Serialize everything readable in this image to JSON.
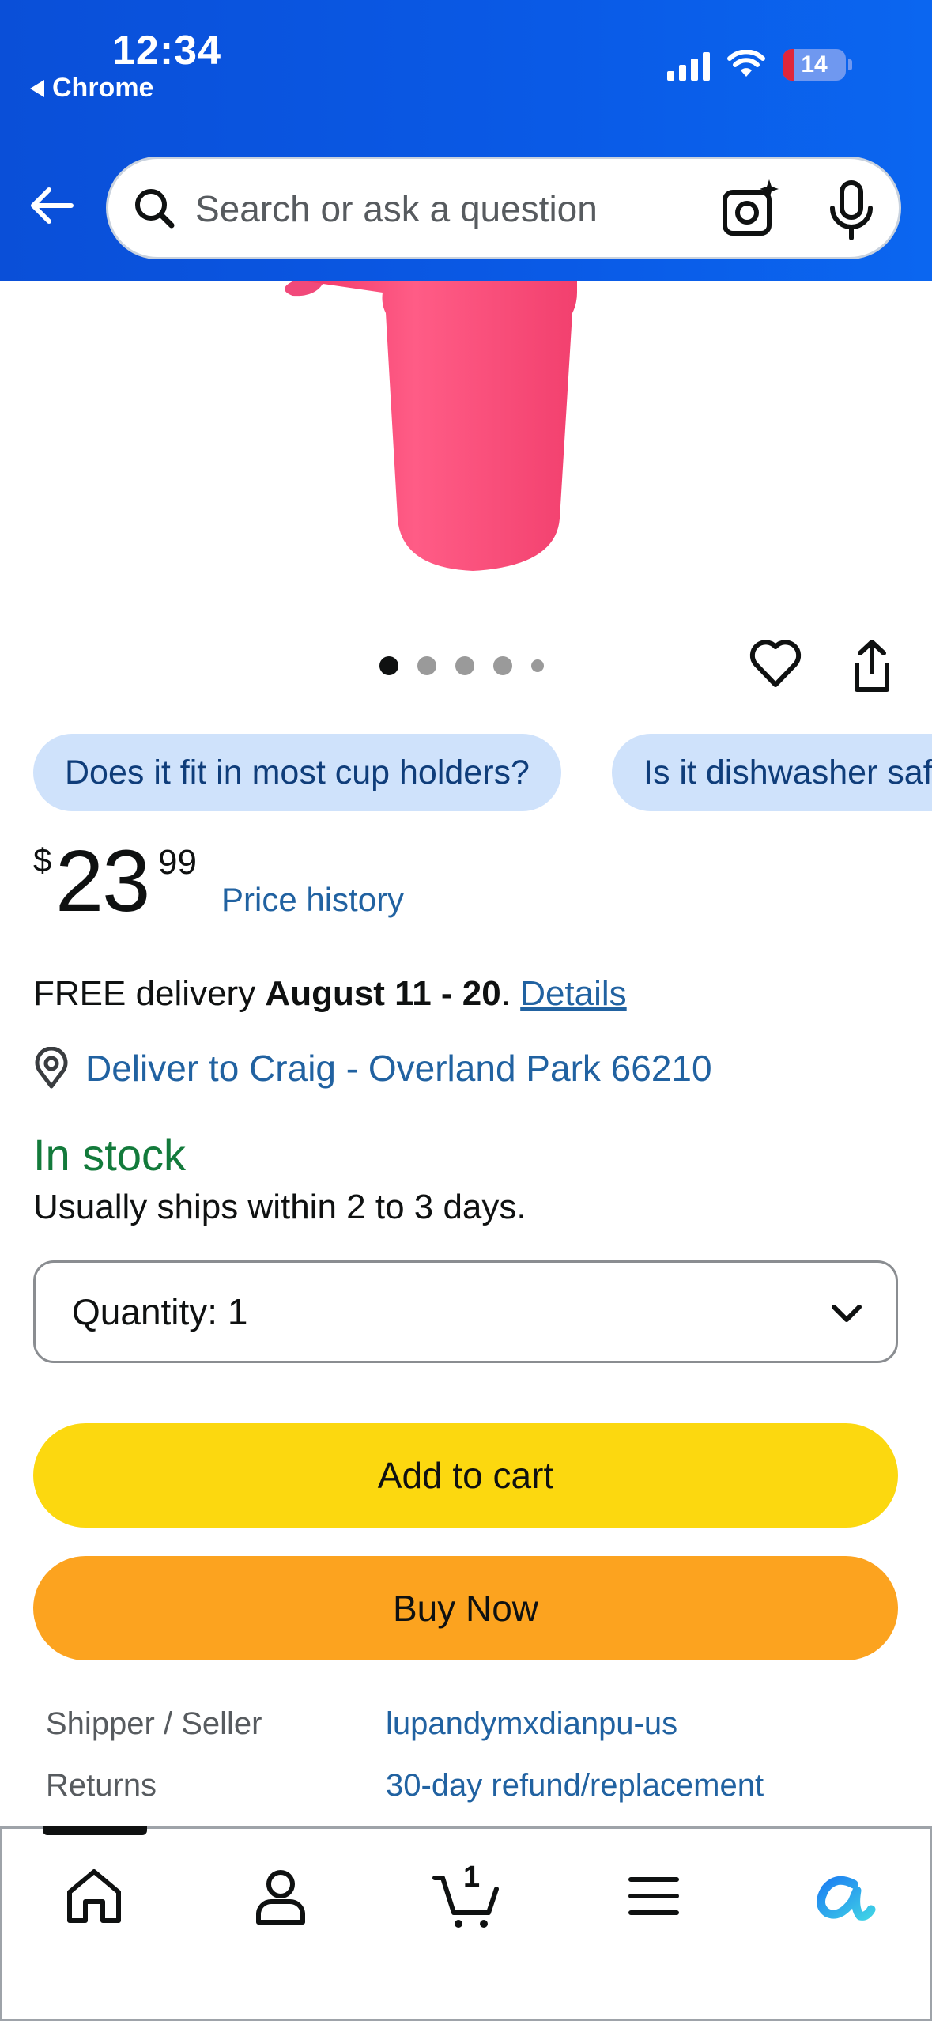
{
  "status_bar": {
    "time": "12:34",
    "back_app": "Chrome",
    "battery": "14",
    "battery_color": "#e0263a"
  },
  "header": {
    "search_placeholder": "Search or ask a question",
    "background_color": "#0a55e0"
  },
  "gallery": {
    "dot_count": 5,
    "active_index": 0
  },
  "chips": [
    "Does it fit in most cup holders?",
    "Is it dishwasher safe?"
  ],
  "price": {
    "currency": "$",
    "whole": "23",
    "fraction": "99",
    "history_label": "Price history"
  },
  "delivery": {
    "prefix": "FREE delivery ",
    "dates": "August 11 - 20",
    "suffix": ". ",
    "details_link": "Details",
    "deliver_to": "Deliver to Craig - Overland Park 66210"
  },
  "stock": {
    "status": "In stock",
    "ships": "Usually ships within 2 to 3 days."
  },
  "quantity": {
    "label": "Quantity:",
    "value": "1"
  },
  "buttons": {
    "add_to_cart": "Add to cart",
    "buy_now": "Buy Now"
  },
  "info": [
    {
      "label": "Shipper / Seller",
      "value": "lupandymxdianpu-us"
    },
    {
      "label": "Returns",
      "value": "30-day refund/replacement"
    }
  ],
  "bottom_nav": {
    "cart_count": "1",
    "items": [
      "home-icon",
      "account-icon",
      "cart-icon",
      "menu-icon",
      "rufus-icon"
    ]
  }
}
